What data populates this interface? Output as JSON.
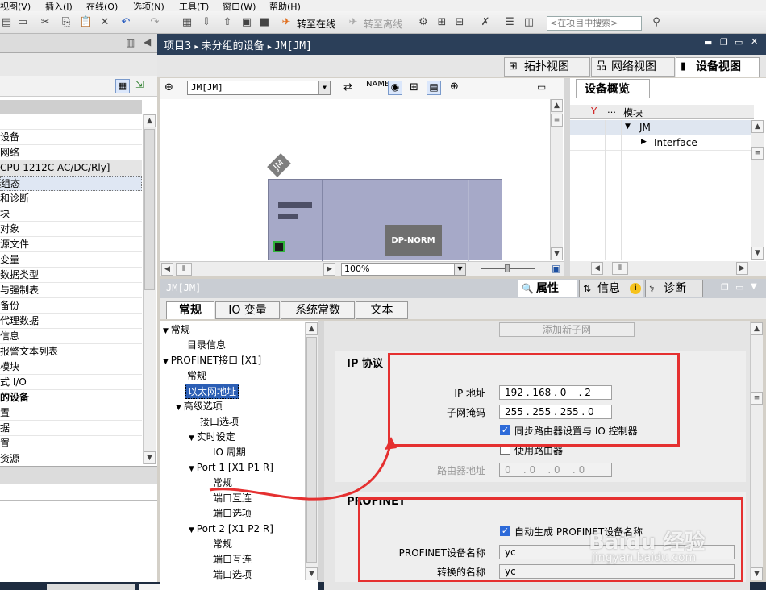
{
  "menu": [
    "视图(V)",
    "插入(I)",
    "在线(O)",
    "选项(N)",
    "工具(T)",
    "窗口(W)",
    "帮助(H)"
  ],
  "toolbar": {
    "go_online": "转至在线",
    "go_offline": "转至离线",
    "search_placeholder": "<在项目中搜索>"
  },
  "left_tree": {
    "items": [
      "设备",
      "网络",
      "CPU 1212C AC/DC/Rly]",
      "组态",
      "和诊断",
      "块",
      "对象",
      "源文件",
      "变量",
      "数据类型",
      "与强制表",
      "备份",
      "代理数据",
      "信息",
      "报警文本列表",
      "模块",
      "式 I/O",
      "的设备",
      "",
      "据",
      "置",
      "资源"
    ]
  },
  "breadcrumb": {
    "project": "项目3",
    "group": "未分组的设备",
    "device": "JM[JM]"
  },
  "view_tabs": {
    "topology": "拓扑视图",
    "network": "网络视图",
    "device": "设备视图"
  },
  "canvas": {
    "device_select": "JM[JM]",
    "device_tag": "JM",
    "module_label": "DP-NORM",
    "zoom": "100%"
  },
  "overview": {
    "tab": "设备概览",
    "col_module": "模块",
    "rows": [
      "JM",
      "Interface"
    ]
  },
  "props": {
    "object_name": "JM[JM]",
    "tabs": {
      "properties": "属性",
      "info": "信息",
      "diagnostics": "诊断"
    },
    "subtabs": [
      "常规",
      "IO 变量",
      "系统常数",
      "文本"
    ]
  },
  "nav_tree": {
    "items": [
      "常规",
      "目录信息",
      "PROFINET接口 [X1]",
      "常规",
      "以太网地址",
      "高级选项",
      "接口选项",
      "实时设定",
      "IO 周期",
      "Port 1 [X1 P1 R]",
      "常规",
      "端口互连",
      "端口选项",
      "Port 2 [X1 P2 R]",
      "常规",
      "端口互连",
      "端口选项"
    ]
  },
  "ip_section": {
    "add_subnet": "添加新子网",
    "title": "IP 协议",
    "ip_label": "IP 地址",
    "ip_value": "192 . 168 . 0    . 2",
    "mask_label": "子网掩码",
    "mask_value": "255 . 255 . 255 . 0",
    "sync_router": "同步路由器设置与 IO 控制器",
    "use_router": "使用路由器",
    "router_label": "路由器地址",
    "router_value": "0    . 0    . 0    . 0"
  },
  "profinet_section": {
    "title": "PROFINET",
    "auto_name": "自动生成 PROFINET设备名称",
    "name_label": "PROFINET设备名称",
    "name_value": "yc",
    "converted_label": "转换的名称",
    "converted_value": "yc"
  },
  "watermark": {
    "line1": "Baidu 经验",
    "line2": "jingyan.baidu.com"
  },
  "colors": {
    "titlebar": "#2b3f59",
    "device": "#a6a9c8",
    "highlight": "#e53030",
    "checkbox": "#2d6ad8"
  }
}
